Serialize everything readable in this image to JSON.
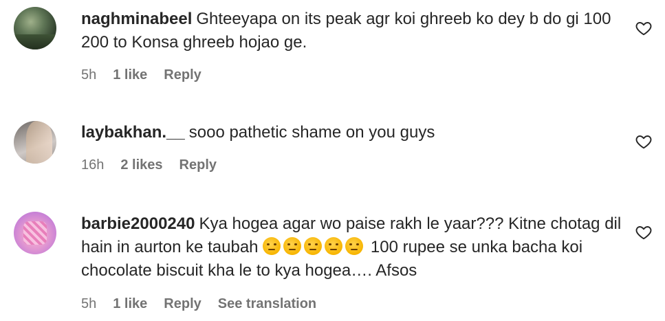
{
  "comments": [
    {
      "username": "naghminabeel",
      "text": "Ghteeyapa on its peak agr koi ghreeb ko dey b do gi 100 200 to Konsa ghreeb hojao ge.",
      "time": "5h",
      "likes": "1 like",
      "reply": "Reply"
    },
    {
      "username": "laybakhan.__",
      "text": "sooo pathetic shame on you guys",
      "time": "16h",
      "likes": "2 likes",
      "reply": "Reply"
    },
    {
      "username": "barbie2000240",
      "text_before": "Kya hogea agar wo paise rakh le yaar??? Kitne chotag dil hain in aurton ke taubah",
      "emojis": [
        "unamused-face",
        "unamused-face",
        "unamused-face",
        "unamused-face",
        "unamused-face"
      ],
      "text_after": "100 rupee se unka bacha koi chocolate biscuit kha le to kya hogea…. Afsos",
      "time": "5h",
      "likes": "1 like",
      "reply": "Reply",
      "translation": "See translation"
    }
  ],
  "icons": {
    "like": "heart-outline-icon"
  },
  "colors": {
    "text": "#262626",
    "meta": "#737373",
    "background": "#ffffff"
  }
}
